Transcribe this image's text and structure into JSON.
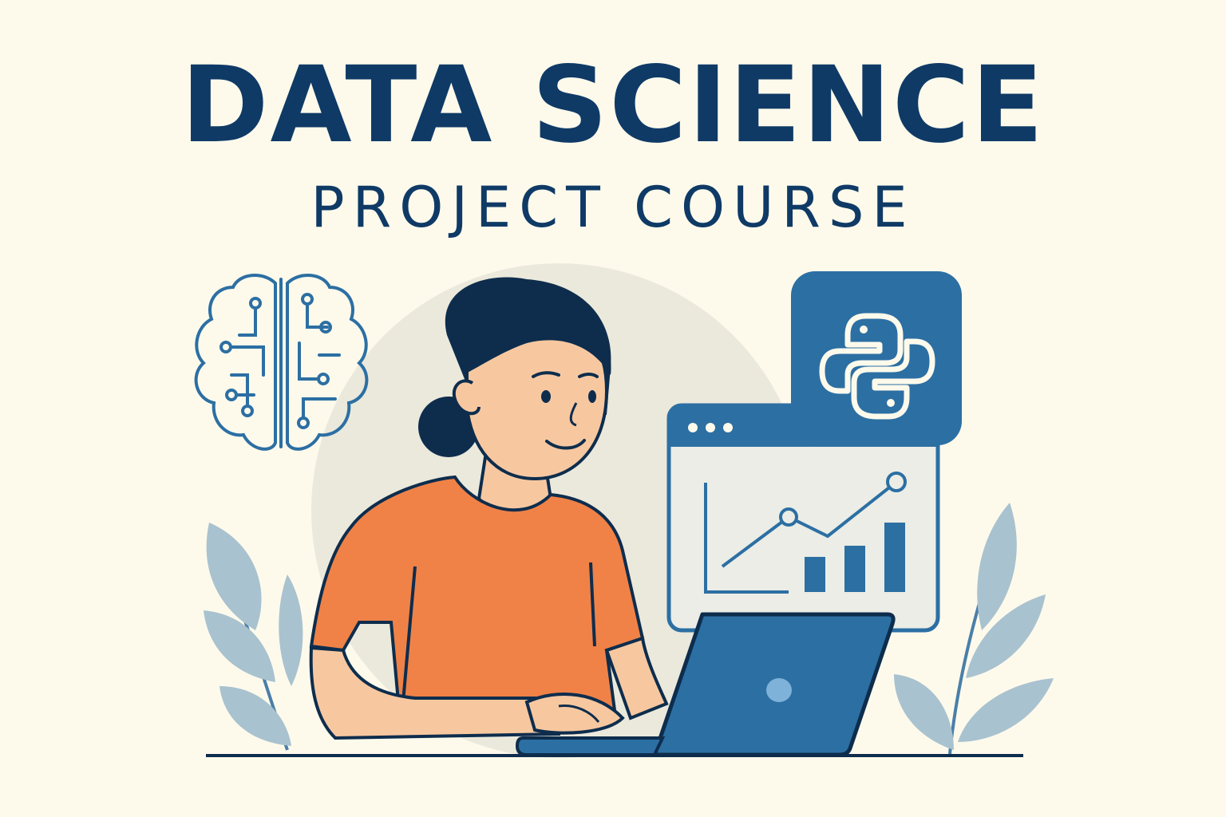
{
  "title": "DATA SCIENCE",
  "subtitle": "PROJECT COURSE",
  "colors": {
    "background": "#fdfaec",
    "navy": "#0f3a66",
    "blue": "#2c6fa3",
    "shirt": "#f08247",
    "skin": "#f7c8a0",
    "leaf": "#a9c2cf"
  },
  "icons": [
    "brain-circuit-icon",
    "python-logo-icon",
    "browser-window-icon",
    "line-bar-chart-icon",
    "laptop-icon",
    "leaf-plant-icon"
  ]
}
